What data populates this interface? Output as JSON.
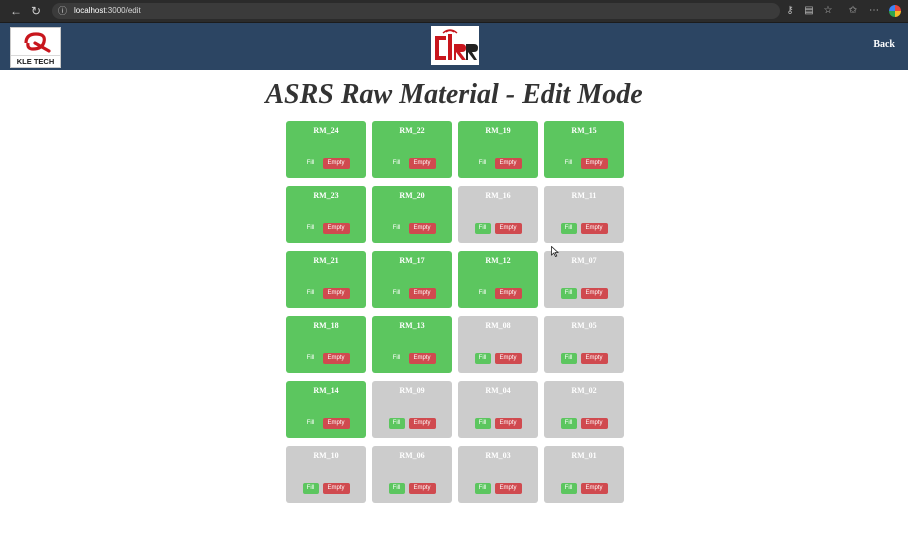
{
  "browser": {
    "url_host": "localhost",
    "url_path": ":3000/edit",
    "info_icon": "info-icon"
  },
  "header": {
    "left_logo_text": "KLE TECH",
    "back_label": "Back"
  },
  "page": {
    "title": "ASRS Raw Material - Edit Mode",
    "fill_label": "Fill",
    "empty_label": "Empty"
  },
  "colors": {
    "filled": "#5cc65f",
    "empty": "#cccccc",
    "empty_button": "#d04a4f",
    "header": "#2c4563"
  },
  "slots": [
    {
      "label": "RM_24",
      "filled": true
    },
    {
      "label": "RM_22",
      "filled": true
    },
    {
      "label": "RM_19",
      "filled": true
    },
    {
      "label": "RM_15",
      "filled": true
    },
    {
      "label": "RM_23",
      "filled": true
    },
    {
      "label": "RM_20",
      "filled": true
    },
    {
      "label": "RM_16",
      "filled": false
    },
    {
      "label": "RM_11",
      "filled": false
    },
    {
      "label": "RM_21",
      "filled": true
    },
    {
      "label": "RM_17",
      "filled": true
    },
    {
      "label": "RM_12",
      "filled": true
    },
    {
      "label": "RM_07",
      "filled": false
    },
    {
      "label": "RM_18",
      "filled": true
    },
    {
      "label": "RM_13",
      "filled": true
    },
    {
      "label": "RM_08",
      "filled": false
    },
    {
      "label": "RM_05",
      "filled": false
    },
    {
      "label": "RM_14",
      "filled": true
    },
    {
      "label": "RM_09",
      "filled": false
    },
    {
      "label": "RM_04",
      "filled": false
    },
    {
      "label": "RM_02",
      "filled": false
    },
    {
      "label": "RM_10",
      "filled": false
    },
    {
      "label": "RM_06",
      "filled": false
    },
    {
      "label": "RM_03",
      "filled": false
    },
    {
      "label": "RM_01",
      "filled": false
    }
  ]
}
